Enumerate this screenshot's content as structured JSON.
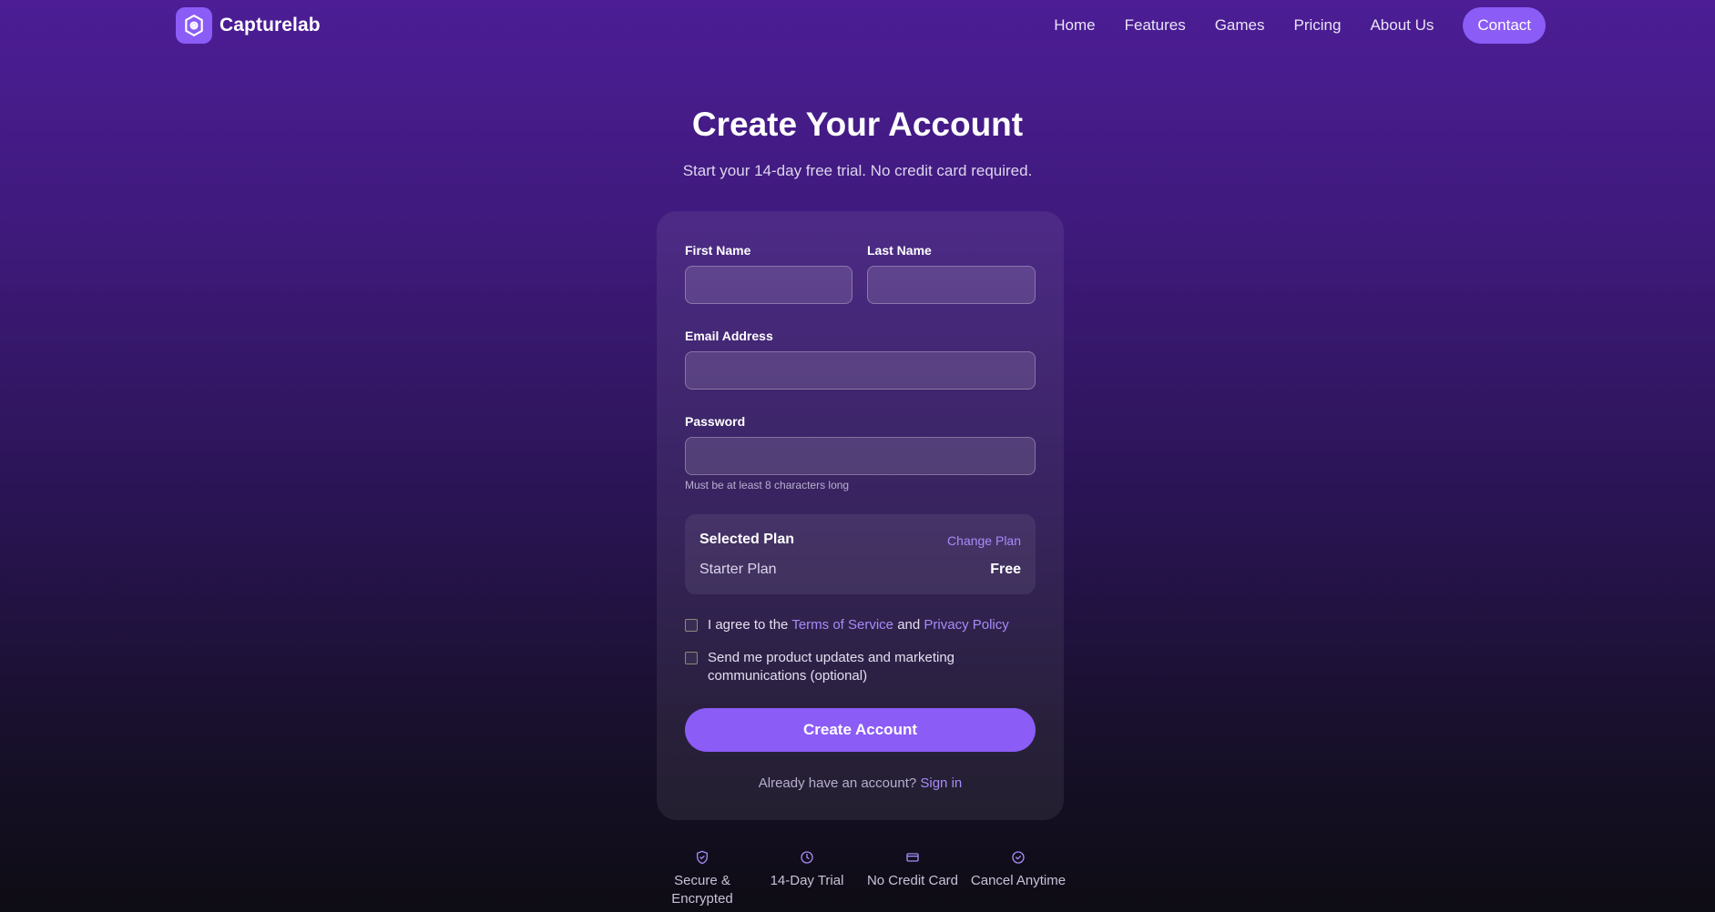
{
  "header": {
    "brand": "Capturelab",
    "nav": [
      "Home",
      "Features",
      "Games",
      "Pricing",
      "About Us"
    ],
    "contact": "Contact"
  },
  "hero": {
    "title": "Create Your Account",
    "subtitle": "Start your 14-day free trial. No credit card required."
  },
  "form": {
    "first_name_label": "First Name",
    "last_name_label": "Last Name",
    "email_label": "Email Address",
    "password_label": "Password",
    "password_hint": "Must be at least 8 characters long",
    "plan": {
      "title": "Selected Plan",
      "change": "Change Plan",
      "name": "Starter Plan",
      "price": "Free"
    },
    "terms": {
      "prefix": "I agree to the",
      "tos": "Terms of Service",
      "and": "and",
      "privacy": "Privacy Policy"
    },
    "marketing": "Send me product updates and marketing communications (optional)",
    "submit": "Create Account",
    "signin_prompt": "Already have an account?",
    "signin_link": "Sign in"
  },
  "features": [
    {
      "icon": "shield-icon",
      "label": "Secure & Encrypted"
    },
    {
      "icon": "clock-icon",
      "label": "14-Day Trial"
    },
    {
      "icon": "credit-card-icon",
      "label": "No Credit Card"
    },
    {
      "icon": "check-circle-icon",
      "label": "Cancel Anytime"
    }
  ],
  "colors": {
    "accent": "#8b5cf6",
    "link": "#a78bfa"
  }
}
